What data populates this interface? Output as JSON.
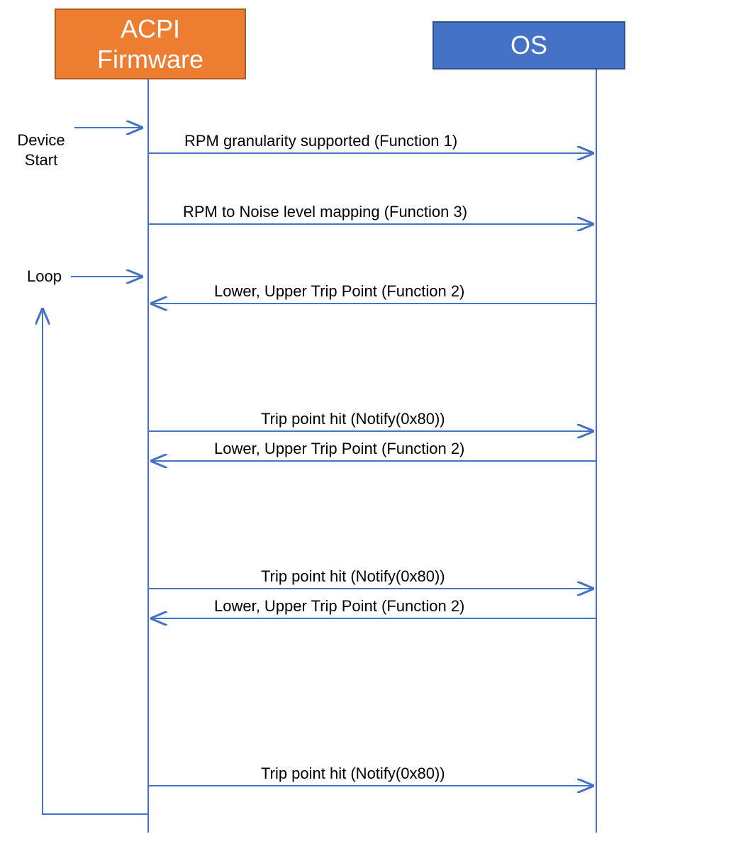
{
  "participants": {
    "acpi": "ACPI\nFirmware",
    "os": "OS"
  },
  "labels": {
    "device_start": "Device\nStart",
    "loop": "Loop"
  },
  "messages": {
    "m1": "RPM granularity supported (Function 1)",
    "m2": "RPM to Noise level mapping (Function 3)",
    "m3": "Lower, Upper Trip Point (Function 2)",
    "m4": "Trip point hit (Notify(0x80))",
    "m5": "Lower, Upper Trip Point (Function 2)",
    "m6": "Trip point hit (Notify(0x80))",
    "m7": "Lower, Upper Trip Point (Function 2)",
    "m8": "Trip point hit (Notify(0x80))"
  },
  "colors": {
    "arrow": "#4472C4",
    "acpi_fill": "#ED7D31",
    "os_fill": "#4472C4"
  },
  "chart_data": {
    "type": "sequence-diagram",
    "participants": [
      "ACPI Firmware",
      "OS"
    ],
    "events": [
      {
        "type": "external",
        "label": "Device Start",
        "to": "ACPI Firmware"
      },
      {
        "type": "message",
        "from": "ACPI Firmware",
        "to": "OS",
        "label": "RPM granularity supported (Function 1)"
      },
      {
        "type": "message",
        "from": "ACPI Firmware",
        "to": "OS",
        "label": "RPM to Noise level mapping (Function 3)"
      },
      {
        "type": "loop_start",
        "label": "Loop"
      },
      {
        "type": "message",
        "from": "OS",
        "to": "ACPI Firmware",
        "label": "Lower, Upper Trip Point (Function 2)"
      },
      {
        "type": "message",
        "from": "ACPI Firmware",
        "to": "OS",
        "label": "Trip point hit (Notify(0x80))"
      },
      {
        "type": "message",
        "from": "OS",
        "to": "ACPI Firmware",
        "label": "Lower, Upper Trip Point (Function 2)"
      },
      {
        "type": "message",
        "from": "ACPI Firmware",
        "to": "OS",
        "label": "Trip point hit (Notify(0x80))"
      },
      {
        "type": "message",
        "from": "OS",
        "to": "ACPI Firmware",
        "label": "Lower, Upper Trip Point (Function 2)"
      },
      {
        "type": "message",
        "from": "ACPI Firmware",
        "to": "OS",
        "label": "Trip point hit (Notify(0x80))"
      },
      {
        "type": "loop_end"
      }
    ]
  }
}
